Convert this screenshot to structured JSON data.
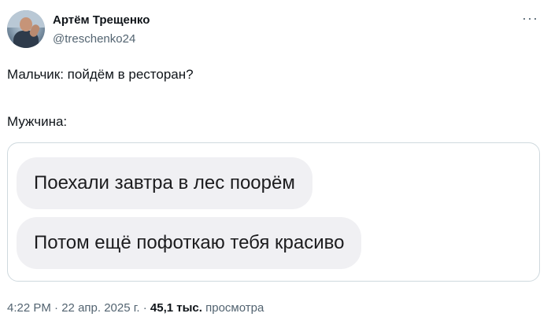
{
  "author": {
    "name": "Артём Трещенко",
    "handle": "@treschenko24"
  },
  "more_label": "···",
  "text": {
    "line1": "Мальчик: пойдём в ресторан?",
    "line2": "Мужчина:"
  },
  "messages": [
    "Поехали завтра в лес поорём",
    "Потом ещё пофоткаю тебя красиво"
  ],
  "meta": {
    "time": "4:22 PM",
    "sep1": " · ",
    "date": "22 апр. 2025 г.",
    "sep2": " · ",
    "views_count": "45,1 тыс.",
    "views_label": " просмотра"
  }
}
